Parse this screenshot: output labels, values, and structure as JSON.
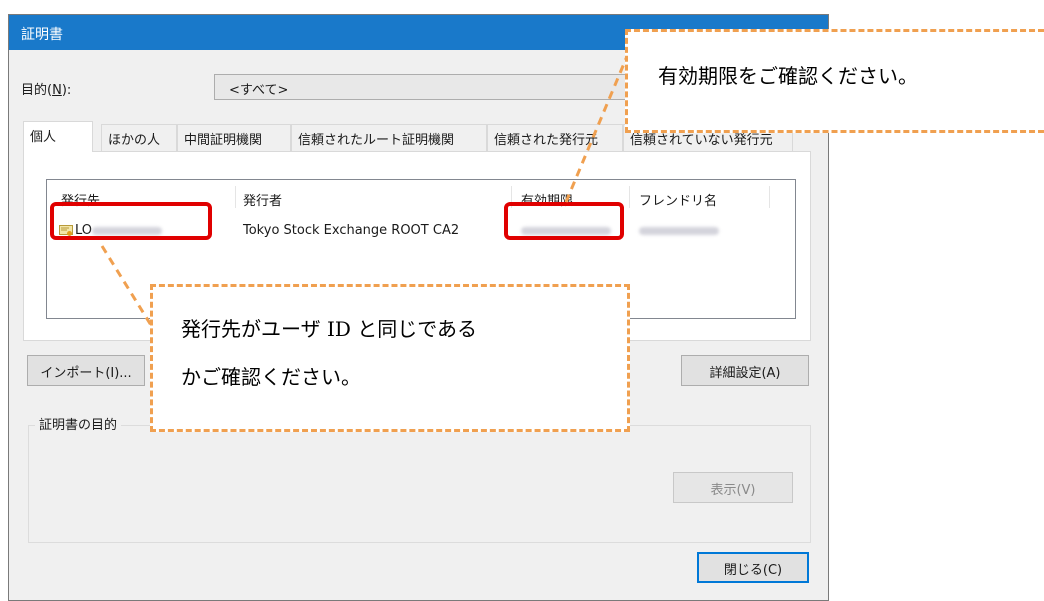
{
  "dialog": {
    "title": "証明書",
    "purpose_label": "目的(",
    "purpose_key": "N",
    "purpose_suffix": "):",
    "purpose_value": "<すべて>",
    "tabs": [
      {
        "label": "個人",
        "active": true
      },
      {
        "label": "ほかの人"
      },
      {
        "label": "中間証明機関"
      },
      {
        "label": "信頼されたルート証明機関"
      },
      {
        "label": "信頼された発行元"
      },
      {
        "label": "信頼されていない発行元"
      }
    ],
    "columns": [
      "発行先",
      "発行者",
      "有効期限",
      "フレンドリ名"
    ],
    "row": {
      "issued_to": "LO",
      "issued_by": "Tokyo Stock Exchange ROOT CA2"
    },
    "buttons": {
      "import": "インポート(I)...",
      "advanced": "詳細設定(A)",
      "view": "表示(V)",
      "close": "閉じる(C)"
    },
    "purpose_group_label": "証明書の目的"
  },
  "callouts": {
    "expiry": "有効期限をご確認ください。",
    "issued_to_line1": "発行先がユーザ ID と同じである",
    "issued_to_line2": "かご確認ください。"
  },
  "colors": {
    "titlebar": "#1979ca",
    "highlight": "#e00000",
    "callout_border": "#f0a050"
  }
}
